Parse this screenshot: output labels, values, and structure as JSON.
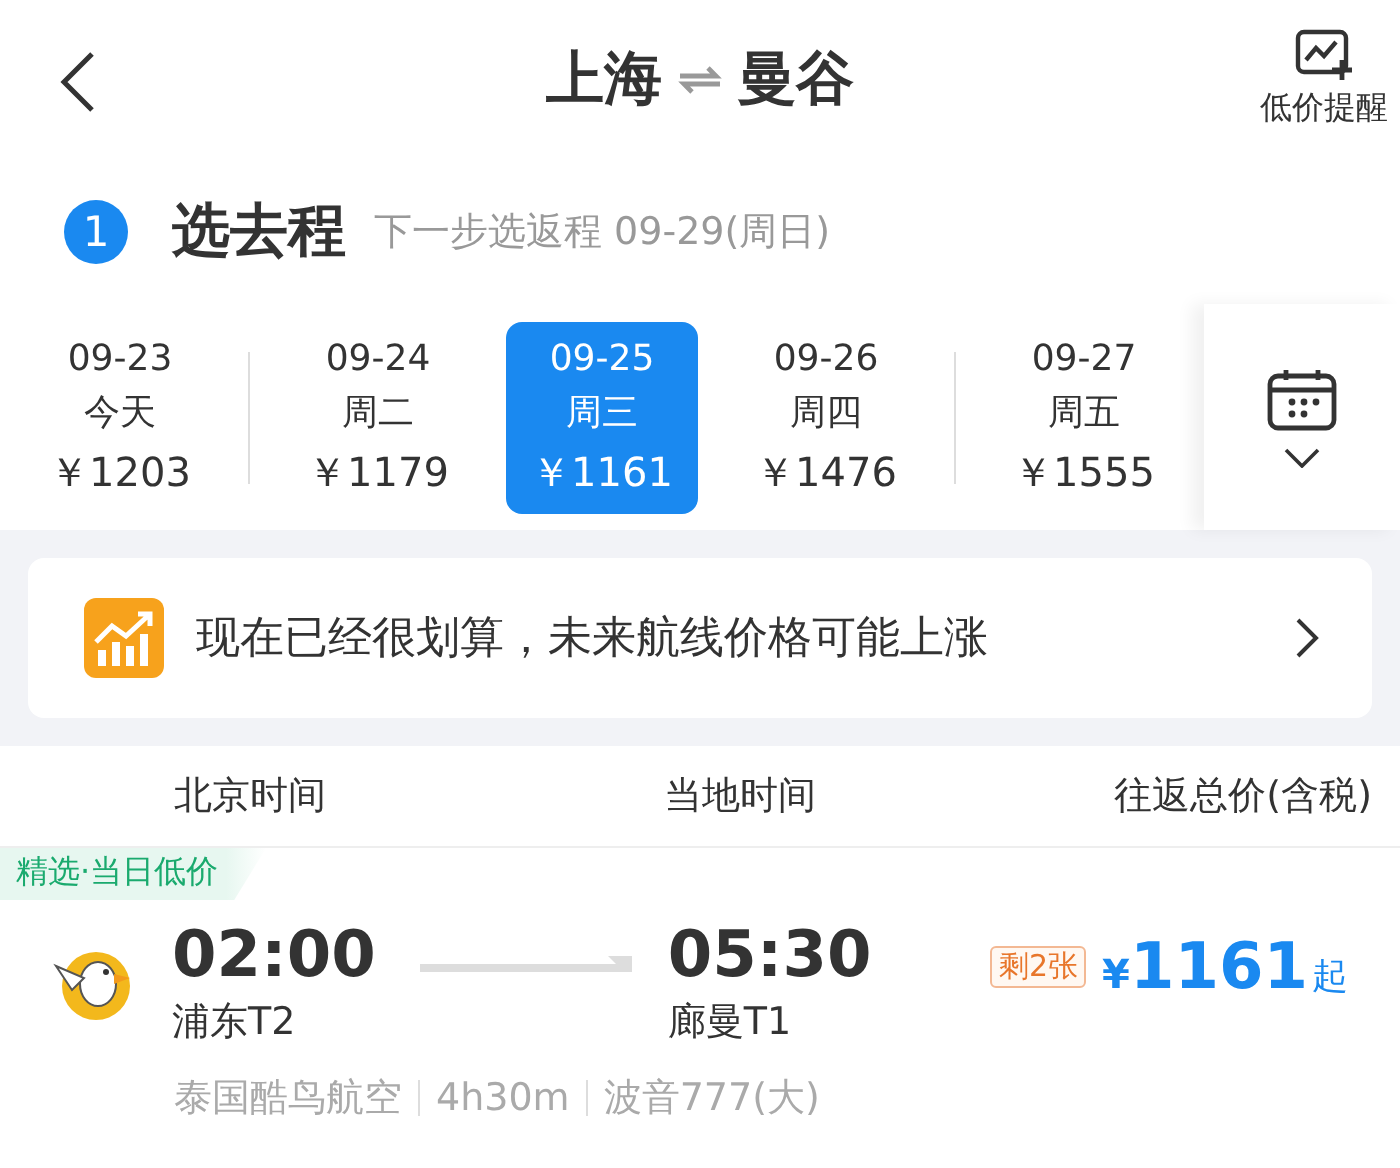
{
  "header": {
    "from": "上海",
    "to": "曼谷",
    "alert_label": "低价提醒"
  },
  "step": {
    "number": "1",
    "title": "选去程",
    "hint": "下一步选返程 09-29(周日)"
  },
  "dates": [
    {
      "date": "09-23",
      "day": "今天",
      "price": "￥1203",
      "selected": false
    },
    {
      "date": "09-24",
      "day": "周二",
      "price": "￥1179",
      "selected": false
    },
    {
      "date": "09-25",
      "day": "周三",
      "price": "￥1161",
      "selected": true
    },
    {
      "date": "09-26",
      "day": "周四",
      "price": "￥1476",
      "selected": false
    },
    {
      "date": "09-27",
      "day": "周五",
      "price": "￥1555",
      "selected": false
    }
  ],
  "notice": {
    "text": "现在已经很划算，未来航线价格可能上涨"
  },
  "columns": [
    "北京时间",
    "当地时间",
    "往返总价(含税)"
  ],
  "flights": [
    {
      "tag": "精选·当日低价",
      "depart_time": "02:00",
      "depart_airport": "浦东T2",
      "arrive_time": "05:30",
      "arrive_airport": "廊曼T1",
      "seats_left": "剩2张",
      "currency": "¥",
      "price": "1161",
      "price_suffix": "起",
      "airline": "泰国酷鸟航空",
      "duration": "4h30m",
      "aircraft": "波音777(大)"
    }
  ]
}
